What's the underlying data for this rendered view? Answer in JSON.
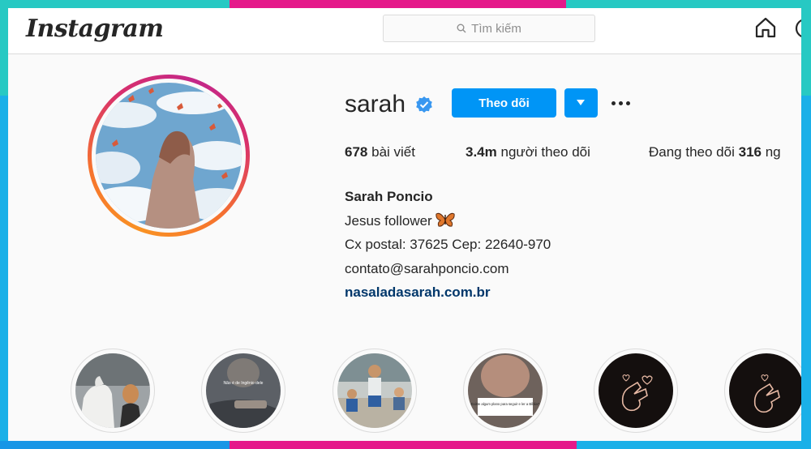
{
  "header": {
    "logo_text": "Instagram",
    "search_placeholder": "Tìm kiếm",
    "icons": [
      "search-icon",
      "home-icon",
      "compass-icon"
    ]
  },
  "profile": {
    "username": "sarah",
    "verified": true,
    "follow_label": "Theo dõi",
    "stats": {
      "posts_count": "678",
      "posts_label": "bài viết",
      "followers_count": "3.4m",
      "followers_label": "người theo dõi",
      "following_prefix": "Đang theo dõi",
      "following_count": "316",
      "following_suffix": "ng"
    },
    "bio": {
      "full_name": "Sarah Poncio",
      "line1": "Jesus follower",
      "line2": "Cx postal: 37625 Cep: 22640-970",
      "line3": "contato@sarahponcio.com",
      "link": "nasaladasarah.com.br"
    }
  },
  "highlights": [
    {
      "caption_text": ""
    },
    {
      "caption_text": "Não é de Ingênio dele"
    },
    {
      "caption_text": ""
    },
    {
      "caption_text": "Existe algum plano para seguir e ler a Bíblia?"
    },
    {
      "caption_text": ""
    },
    {
      "caption_text": ""
    }
  ],
  "colors": {
    "accent": "#0095f6",
    "link": "#00376b",
    "verified": "#3897f0",
    "frame_teal": "#27c9c3",
    "frame_pink": "#e5198a",
    "frame_blue": "#1ab0e8"
  }
}
